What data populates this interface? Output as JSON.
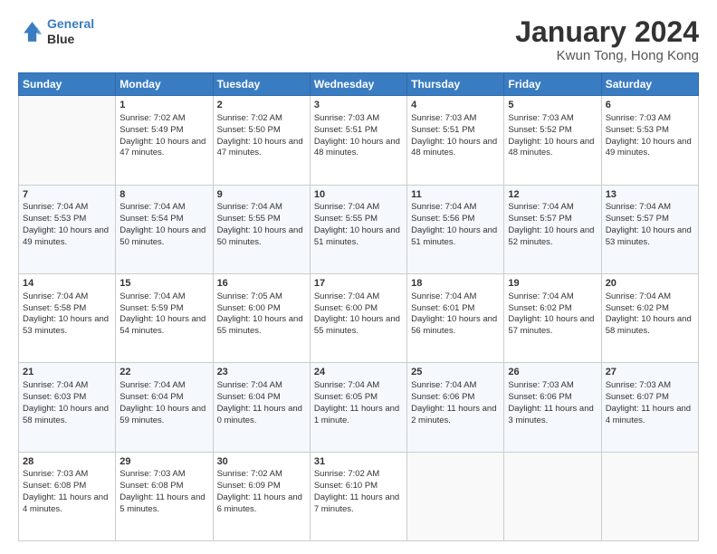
{
  "header": {
    "logo_line1": "General",
    "logo_line2": "Blue",
    "title": "January 2024",
    "subtitle": "Kwun Tong, Hong Kong"
  },
  "weekdays": [
    "Sunday",
    "Monday",
    "Tuesday",
    "Wednesday",
    "Thursday",
    "Friday",
    "Saturday"
  ],
  "weeks": [
    [
      {
        "day": "",
        "sunrise": "",
        "sunset": "",
        "daylight": ""
      },
      {
        "day": "1",
        "sunrise": "Sunrise: 7:02 AM",
        "sunset": "Sunset: 5:49 PM",
        "daylight": "Daylight: 10 hours and 47 minutes."
      },
      {
        "day": "2",
        "sunrise": "Sunrise: 7:02 AM",
        "sunset": "Sunset: 5:50 PM",
        "daylight": "Daylight: 10 hours and 47 minutes."
      },
      {
        "day": "3",
        "sunrise": "Sunrise: 7:03 AM",
        "sunset": "Sunset: 5:51 PM",
        "daylight": "Daylight: 10 hours and 48 minutes."
      },
      {
        "day": "4",
        "sunrise": "Sunrise: 7:03 AM",
        "sunset": "Sunset: 5:51 PM",
        "daylight": "Daylight: 10 hours and 48 minutes."
      },
      {
        "day": "5",
        "sunrise": "Sunrise: 7:03 AM",
        "sunset": "Sunset: 5:52 PM",
        "daylight": "Daylight: 10 hours and 48 minutes."
      },
      {
        "day": "6",
        "sunrise": "Sunrise: 7:03 AM",
        "sunset": "Sunset: 5:53 PM",
        "daylight": "Daylight: 10 hours and 49 minutes."
      }
    ],
    [
      {
        "day": "7",
        "sunrise": "Sunrise: 7:04 AM",
        "sunset": "Sunset: 5:53 PM",
        "daylight": "Daylight: 10 hours and 49 minutes."
      },
      {
        "day": "8",
        "sunrise": "Sunrise: 7:04 AM",
        "sunset": "Sunset: 5:54 PM",
        "daylight": "Daylight: 10 hours and 50 minutes."
      },
      {
        "day": "9",
        "sunrise": "Sunrise: 7:04 AM",
        "sunset": "Sunset: 5:55 PM",
        "daylight": "Daylight: 10 hours and 50 minutes."
      },
      {
        "day": "10",
        "sunrise": "Sunrise: 7:04 AM",
        "sunset": "Sunset: 5:55 PM",
        "daylight": "Daylight: 10 hours and 51 minutes."
      },
      {
        "day": "11",
        "sunrise": "Sunrise: 7:04 AM",
        "sunset": "Sunset: 5:56 PM",
        "daylight": "Daylight: 10 hours and 51 minutes."
      },
      {
        "day": "12",
        "sunrise": "Sunrise: 7:04 AM",
        "sunset": "Sunset: 5:57 PM",
        "daylight": "Daylight: 10 hours and 52 minutes."
      },
      {
        "day": "13",
        "sunrise": "Sunrise: 7:04 AM",
        "sunset": "Sunset: 5:57 PM",
        "daylight": "Daylight: 10 hours and 53 minutes."
      }
    ],
    [
      {
        "day": "14",
        "sunrise": "Sunrise: 7:04 AM",
        "sunset": "Sunset: 5:58 PM",
        "daylight": "Daylight: 10 hours and 53 minutes."
      },
      {
        "day": "15",
        "sunrise": "Sunrise: 7:04 AM",
        "sunset": "Sunset: 5:59 PM",
        "daylight": "Daylight: 10 hours and 54 minutes."
      },
      {
        "day": "16",
        "sunrise": "Sunrise: 7:05 AM",
        "sunset": "Sunset: 6:00 PM",
        "daylight": "Daylight: 10 hours and 55 minutes."
      },
      {
        "day": "17",
        "sunrise": "Sunrise: 7:04 AM",
        "sunset": "Sunset: 6:00 PM",
        "daylight": "Daylight: 10 hours and 55 minutes."
      },
      {
        "day": "18",
        "sunrise": "Sunrise: 7:04 AM",
        "sunset": "Sunset: 6:01 PM",
        "daylight": "Daylight: 10 hours and 56 minutes."
      },
      {
        "day": "19",
        "sunrise": "Sunrise: 7:04 AM",
        "sunset": "Sunset: 6:02 PM",
        "daylight": "Daylight: 10 hours and 57 minutes."
      },
      {
        "day": "20",
        "sunrise": "Sunrise: 7:04 AM",
        "sunset": "Sunset: 6:02 PM",
        "daylight": "Daylight: 10 hours and 58 minutes."
      }
    ],
    [
      {
        "day": "21",
        "sunrise": "Sunrise: 7:04 AM",
        "sunset": "Sunset: 6:03 PM",
        "daylight": "Daylight: 10 hours and 58 minutes."
      },
      {
        "day": "22",
        "sunrise": "Sunrise: 7:04 AM",
        "sunset": "Sunset: 6:04 PM",
        "daylight": "Daylight: 10 hours and 59 minutes."
      },
      {
        "day": "23",
        "sunrise": "Sunrise: 7:04 AM",
        "sunset": "Sunset: 6:04 PM",
        "daylight": "Daylight: 11 hours and 0 minutes."
      },
      {
        "day": "24",
        "sunrise": "Sunrise: 7:04 AM",
        "sunset": "Sunset: 6:05 PM",
        "daylight": "Daylight: 11 hours and 1 minute."
      },
      {
        "day": "25",
        "sunrise": "Sunrise: 7:04 AM",
        "sunset": "Sunset: 6:06 PM",
        "daylight": "Daylight: 11 hours and 2 minutes."
      },
      {
        "day": "26",
        "sunrise": "Sunrise: 7:03 AM",
        "sunset": "Sunset: 6:06 PM",
        "daylight": "Daylight: 11 hours and 3 minutes."
      },
      {
        "day": "27",
        "sunrise": "Sunrise: 7:03 AM",
        "sunset": "Sunset: 6:07 PM",
        "daylight": "Daylight: 11 hours and 4 minutes."
      }
    ],
    [
      {
        "day": "28",
        "sunrise": "Sunrise: 7:03 AM",
        "sunset": "Sunset: 6:08 PM",
        "daylight": "Daylight: 11 hours and 4 minutes."
      },
      {
        "day": "29",
        "sunrise": "Sunrise: 7:03 AM",
        "sunset": "Sunset: 6:08 PM",
        "daylight": "Daylight: 11 hours and 5 minutes."
      },
      {
        "day": "30",
        "sunrise": "Sunrise: 7:02 AM",
        "sunset": "Sunset: 6:09 PM",
        "daylight": "Daylight: 11 hours and 6 minutes."
      },
      {
        "day": "31",
        "sunrise": "Sunrise: 7:02 AM",
        "sunset": "Sunset: 6:10 PM",
        "daylight": "Daylight: 11 hours and 7 minutes."
      },
      {
        "day": "",
        "sunrise": "",
        "sunset": "",
        "daylight": ""
      },
      {
        "day": "",
        "sunrise": "",
        "sunset": "",
        "daylight": ""
      },
      {
        "day": "",
        "sunrise": "",
        "sunset": "",
        "daylight": ""
      }
    ]
  ]
}
